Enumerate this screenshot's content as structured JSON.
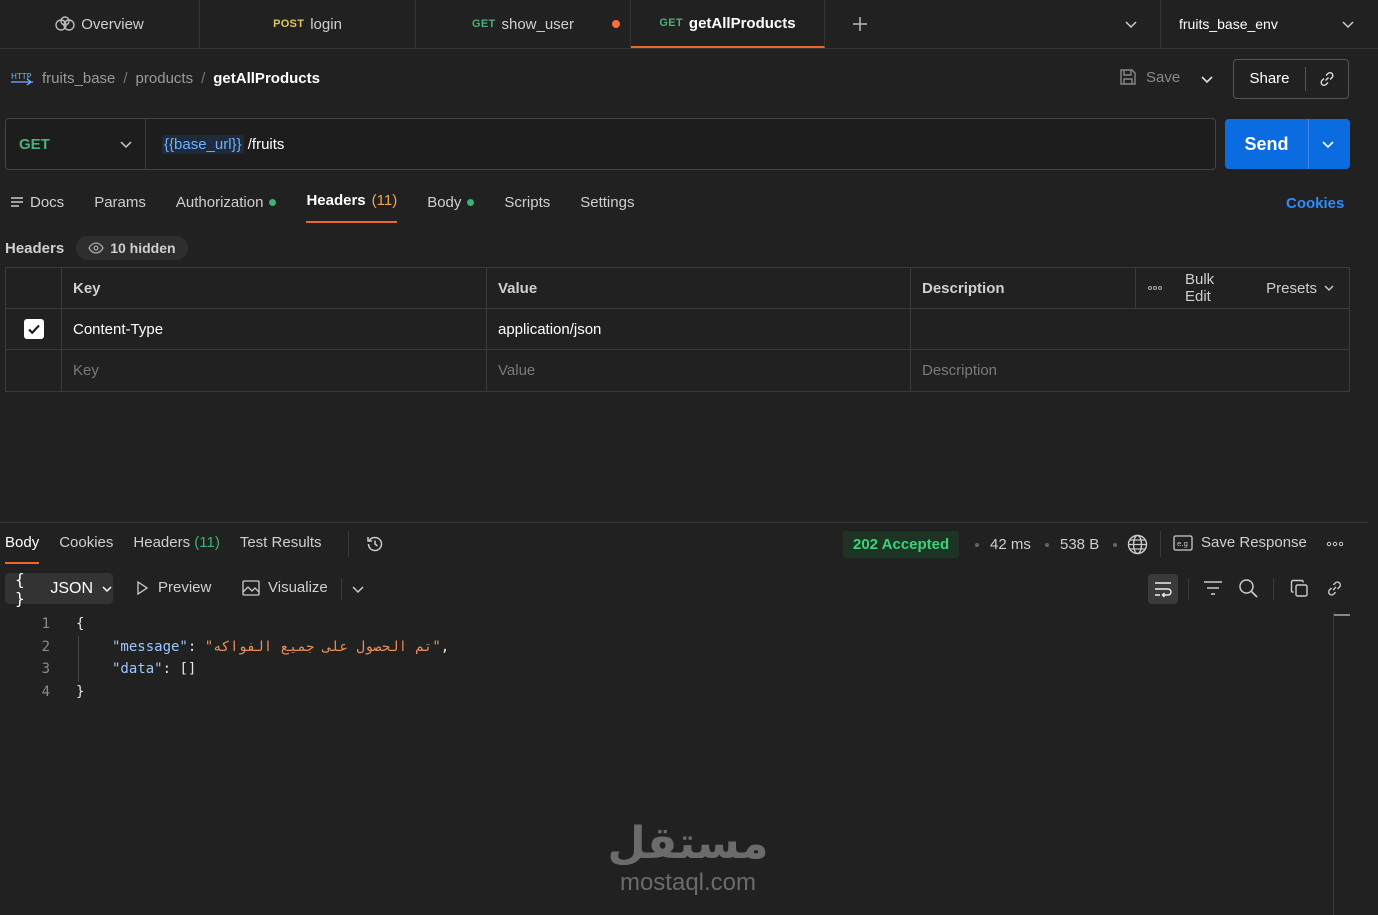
{
  "tabs": [
    {
      "method": "",
      "label": "Overview"
    },
    {
      "method": "POST",
      "label": "login"
    },
    {
      "method": "GET",
      "label": "show_user"
    },
    {
      "method": "GET",
      "label": "getAllProducts"
    }
  ],
  "environment": "fruits_base_env",
  "breadcrumb": {
    "collection": "fruits_base",
    "folder": "products",
    "request": "getAllProducts",
    "sep": "/"
  },
  "toolbar": {
    "save_label": "Save",
    "share_label": "Share"
  },
  "request": {
    "method": "GET",
    "url_var": "{{base_url}}",
    "url_path": "/fruits",
    "send_label": "Send"
  },
  "request_tabs": {
    "docs": "Docs",
    "params": "Params",
    "authorization": "Authorization",
    "headers": "Headers",
    "headers_count": "(11)",
    "body": "Body",
    "scripts": "Scripts",
    "settings": "Settings",
    "cookies": "Cookies"
  },
  "headers_section": {
    "label": "Headers",
    "hidden": "10 hidden"
  },
  "headers_table": {
    "col_key": "Key",
    "col_value": "Value",
    "col_description": "Description",
    "bulk_edit": "Bulk Edit",
    "presets": "Presets",
    "rows": [
      {
        "key": "Content-Type",
        "value": "application/json",
        "description": "",
        "checked": true
      }
    ],
    "placeholder": {
      "key": "Key",
      "value": "Value",
      "description": "Description"
    }
  },
  "response_tabs": {
    "body": "Body",
    "cookies": "Cookies",
    "headers": "Headers",
    "headers_count": "(11)",
    "test_results": "Test Results"
  },
  "response_meta": {
    "status": "202 Accepted",
    "time": "42 ms",
    "size": "538 B",
    "save_response": "Save Response",
    "status_color": "#3bd37a"
  },
  "response_view": {
    "format": "JSON",
    "preview": "Preview",
    "visualize": "Visualize"
  },
  "response_body": {
    "line_numbers": [
      "1",
      "2",
      "3",
      "4"
    ],
    "open_brace": "{",
    "close_brace": "}",
    "message_key": "\"message\"",
    "message_value": "\"تم الحصول على جميع الفواكه\"",
    "data_key": "\"data\"",
    "data_value": "[]"
  },
  "watermark": {
    "arabic": "مستقل",
    "latin": "mostaql.com"
  },
  "colors": {
    "accent": "#e8682d",
    "send": "#0b6be0",
    "get": "#4caf7a",
    "link": "#2d8cff"
  }
}
